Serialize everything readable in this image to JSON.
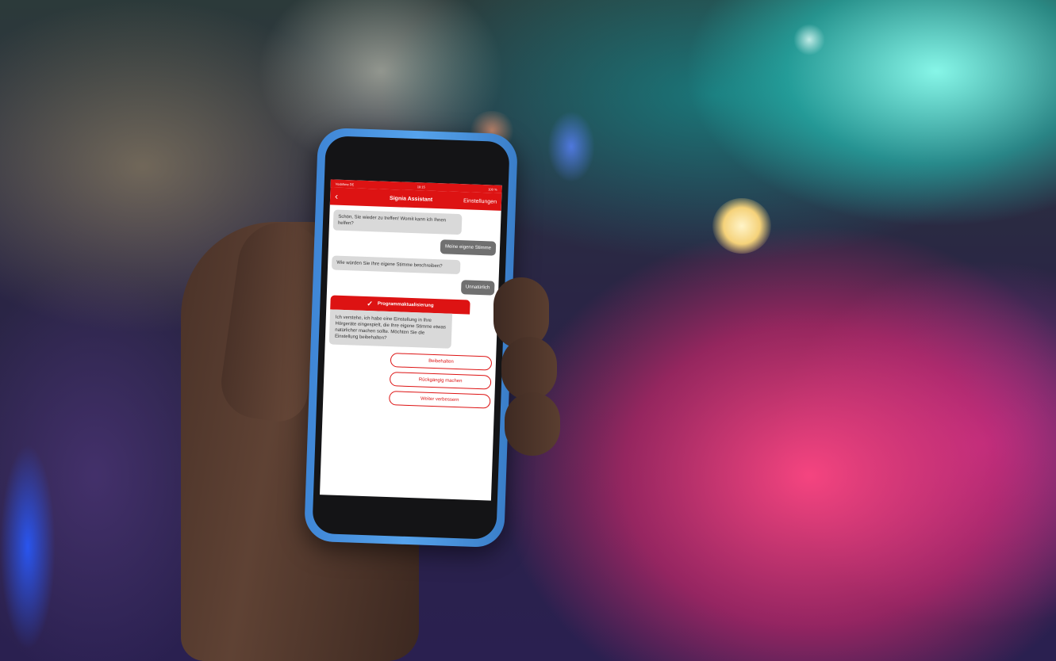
{
  "app": {
    "status_left": "Vodafone DE",
    "status_time": "19:15",
    "status_right": "100 %",
    "title": "Signia Assistant",
    "settings_label": "Einstellungen",
    "back_icon": "chevron-left-icon"
  },
  "chat": {
    "messages": [
      {
        "from": "assistant",
        "text": "Schön, Sie wieder zu treffen! Womit kann ich Ihnen helfen?"
      },
      {
        "from": "user",
        "text": "Meine eigene Stimme"
      },
      {
        "from": "assistant",
        "text": "Wie würden Sie Ihre eigene Stimme beschreiben?"
      },
      {
        "from": "user",
        "text": "Unnatürlich"
      }
    ],
    "update_card": {
      "title": "Programmaktualisierung",
      "icon": "check-icon",
      "body": "Ich verstehe, ich habe eine Einstellung in Ihre Hörgeräte eingespielt, die Ihre eigene Stimme etwas natürlicher machen sollte. Möchten Sie die Einstellung beibehalten?"
    },
    "options": [
      "Beibehalten",
      "Rückgängig machen",
      "Weiter verbessern"
    ]
  },
  "colors": {
    "brand_red": "#dd1313",
    "phone_case": "#4c96e2"
  }
}
